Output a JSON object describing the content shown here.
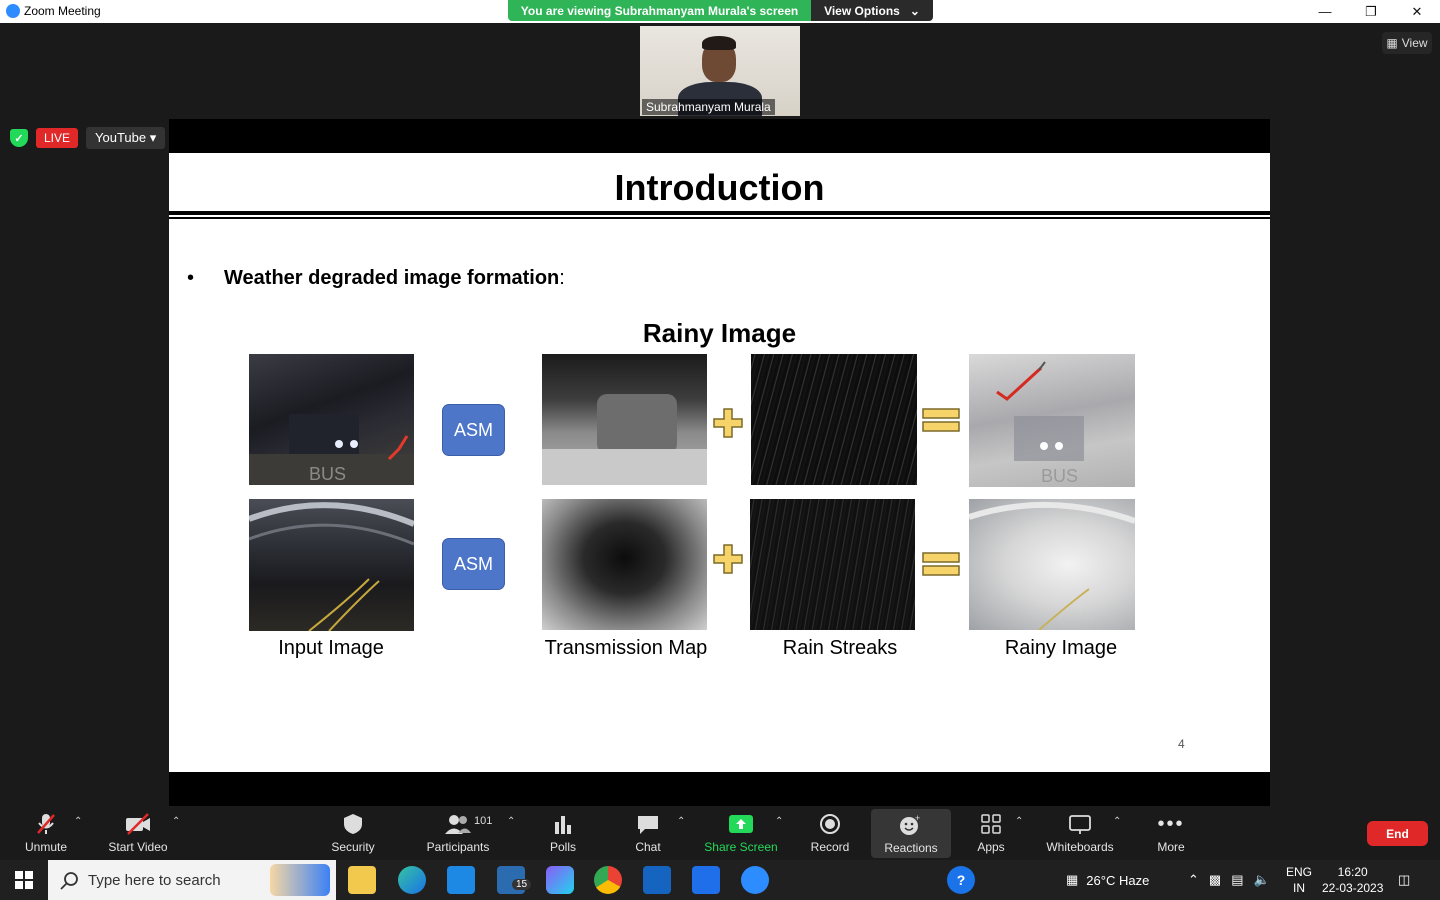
{
  "window": {
    "title": "Zoom Meeting"
  },
  "banner": {
    "message": "You are viewing Subrahmanyam Murala's screen",
    "options_label": "View Options"
  },
  "stage": {
    "view_label": "View",
    "speaker_name": "Subrahmanyam Murala",
    "live_label": "LIVE",
    "stream_target": "YouTube"
  },
  "slide": {
    "title": "Introduction",
    "bullet": "Weather degraded image formation",
    "bullet_suffix": ":",
    "figure_title": "Rainy Image",
    "asm_label": "ASM",
    "captions": [
      "Input Image",
      "Transmission Map",
      "Rain Streaks",
      "Rainy Image"
    ],
    "page_number": "4"
  },
  "toolbar": {
    "unmute": "Unmute",
    "start_video": "Start Video",
    "security": "Security",
    "participants": "Participants",
    "participants_count": "101",
    "polls": "Polls",
    "chat": "Chat",
    "share_screen": "Share Screen",
    "record": "Record",
    "reactions": "Reactions",
    "apps": "Apps",
    "whiteboards": "Whiteboards",
    "more": "More",
    "end": "End"
  },
  "taskbar": {
    "search_placeholder": "Type here to search",
    "mail_badge": "15",
    "weather": "26°C  Haze",
    "lang_top": "ENG",
    "lang_bottom": "IN",
    "time": "16:20",
    "date": "22-03-2023"
  },
  "colors": {
    "share_green": "#23d959",
    "live_red": "#e02828",
    "asm_blue": "#4d76c9",
    "banner_green": "#2fb457"
  }
}
